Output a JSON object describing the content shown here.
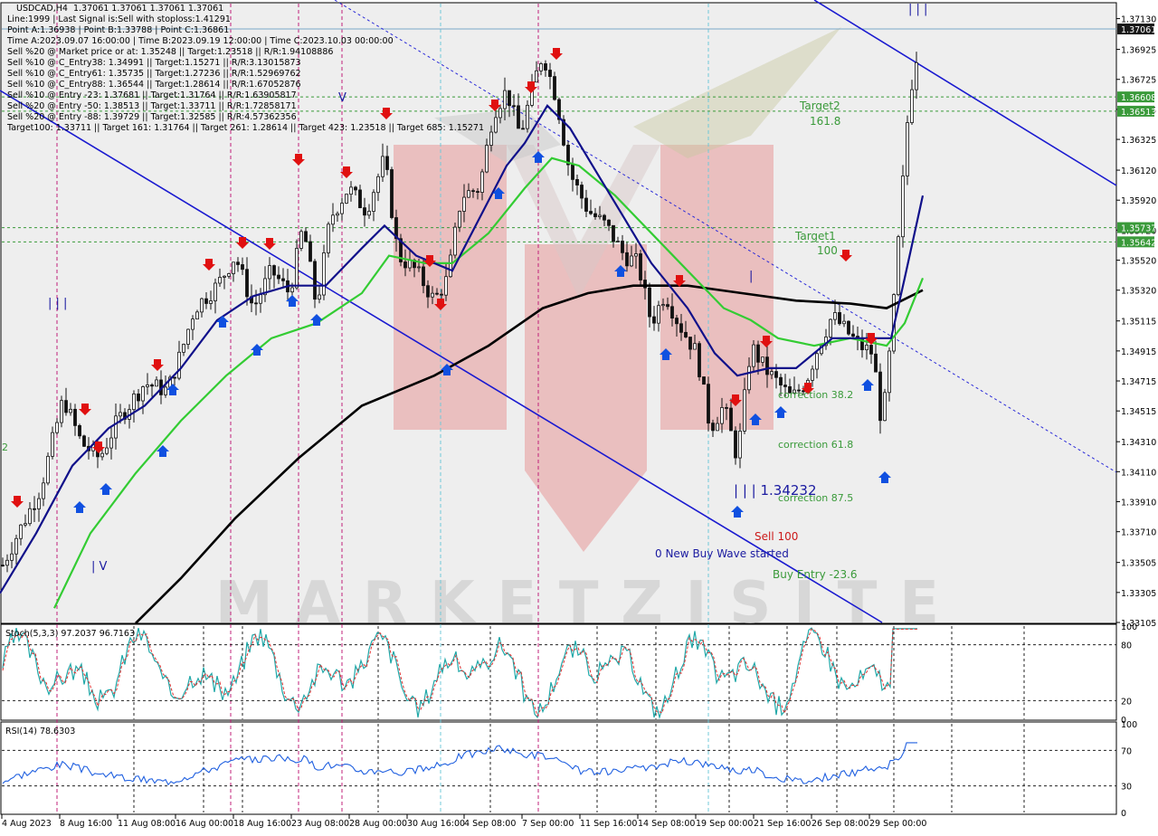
{
  "symbol_header": "USDCAD,H4  1.37061 1.37061 1.37061 1.37061",
  "info_lines": [
    "Line:1999 | Last Signal is:Sell with stoploss:1.41291",
    "Point A:1.36938 | Point B:1.33788 | Point C:1.36861",
    "Time A:2023.09.07 16:00:00 | Time B:2023.09.19 12:00:00 | Time C:2023.10.03 00:00:00",
    "Sell %20 @ Market price or at: 1.35248 || Target:1.23518 || R/R:1.94108886",
    "Sell %10 @ C_Entry38: 1.34991 || Target:1.15271 || R/R:3.13015873",
    "Sell %10 @ C_Entry61: 1.35735 || Target:1.27236 || R/R:1.52969762",
    "Sell %10 @ C_Entry88: 1.36544 || Target:1.28614 || R/R:1.67052876",
    "Sell %10 @ Entry -23: 1.37681 || Target:1.31764 || R/R:1.63905817",
    "Sell %20 @ Entry -50: 1.38513 || Target:1.33711 || R/R:1.72858171",
    "Sell %20 @ Entry -88: 1.39729 || Target:1.32585 || R/R:4.57362356",
    "Target100: 1.33711 || Target 161: 1.31764 || Target 261: 1.28614 || Target 423: 1.23518 || Target 685: 1.15271"
  ],
  "annotations": {
    "target2": "Target2",
    "target2_val": "161.8",
    "target1": "Target1",
    "target1_val": "100",
    "correction382": "correction 38.2",
    "correction618": "correction 61.8",
    "correction875": "correction 87.5",
    "point_b_label": "| | | 1.34232",
    "sell100": "Sell 100",
    "new_buy_wave": "0 New Buy Wave started",
    "buy_entry": "Buy Entry -23.6",
    "wave_iii_left": "| | |",
    "wave_iv_left": "| V",
    "wave_v_top": "V",
    "wave_i_mid": "|",
    "wave_top_right": "| | |",
    "watermark": "MARKETZISITE",
    "left_edge_digit": "2"
  },
  "stoch_label": "Stoch(5,3,3) 97.2037 96.7163",
  "rsi_label": "RSI(14) 78.6303",
  "stoch_levels": [
    "100",
    "80",
    "20",
    "0"
  ],
  "rsi_levels": [
    "100",
    "70",
    "30",
    "0"
  ],
  "price_ticks": [
    "1.37130",
    "1.36925",
    "1.36725",
    "1.36525",
    "1.36325",
    "1.36120",
    "1.35920",
    "1.35720",
    "1.35520",
    "1.35320",
    "1.35115",
    "1.34915",
    "1.34715",
    "1.34515",
    "1.34310",
    "1.34110",
    "1.33910",
    "1.33710",
    "1.33505",
    "1.33305",
    "1.33105"
  ],
  "price_markers": [
    {
      "label": "1.37061",
      "value": 1.37061,
      "color": "#1a1a1a"
    },
    {
      "label": "1.36608",
      "value": 1.36608,
      "color": "#3a9a3a"
    },
    {
      "label": "1.36513",
      "value": 1.36513,
      "color": "#3a9a3a"
    },
    {
      "label": "1.35737",
      "value": 1.35737,
      "color": "#3a9a3a"
    },
    {
      "label": "1.35642",
      "value": 1.35642,
      "color": "#3a9a3a"
    }
  ],
  "time_ticks": [
    "4 Aug 2023",
    "8 Aug 16:00",
    "11 Aug 08:00",
    "16 Aug 00:00",
    "18 Aug 16:00",
    "23 Aug 08:00",
    "28 Aug 00:00",
    "30 Aug 16:00",
    "4 Sep 08:00",
    "7 Sep 00:00",
    "11 Sep 16:00",
    "14 Sep 08:00",
    "19 Sep 00:00",
    "21 Sep 16:00",
    "26 Sep 08:00",
    "29 Sep 00:00"
  ],
  "chart_data": {
    "type": "candlestick",
    "symbol": "USDCAD",
    "timeframe": "H4",
    "ylim": [
      1.33105,
      1.3723
    ],
    "last_price": 1.37061,
    "close_path": [
      [
        0,
        1.3345
      ],
      [
        20,
        1.337
      ],
      [
        45,
        1.34
      ],
      [
        70,
        1.346
      ],
      [
        90,
        1.343
      ],
      [
        110,
        1.342
      ],
      [
        130,
        1.3445
      ],
      [
        160,
        1.347
      ],
      [
        185,
        1.3465
      ],
      [
        200,
        1.349
      ],
      [
        215,
        1.352
      ],
      [
        240,
        1.3535
      ],
      [
        260,
        1.3555
      ],
      [
        280,
        1.352
      ],
      [
        300,
        1.3545
      ],
      [
        320,
        1.353
      ],
      [
        335,
        1.3575
      ],
      [
        350,
        1.352
      ],
      [
        365,
        1.358
      ],
      [
        385,
        1.36
      ],
      [
        405,
        1.3585
      ],
      [
        425,
        1.362
      ],
      [
        440,
        1.3555
      ],
      [
        460,
        1.3545
      ],
      [
        480,
        1.3525
      ],
      [
        495,
        1.354
      ],
      [
        510,
        1.3595
      ],
      [
        530,
        1.36
      ],
      [
        545,
        1.365
      ],
      [
        560,
        1.3665
      ],
      [
        575,
        1.3635
      ],
      [
        590,
        1.367
      ],
      [
        600,
        1.369
      ],
      [
        615,
        1.366
      ],
      [
        630,
        1.361
      ],
      [
        650,
        1.3585
      ],
      [
        670,
        1.3575
      ],
      [
        690,
        1.3555
      ],
      [
        705,
        1.355
      ],
      [
        720,
        1.351
      ],
      [
        735,
        1.353
      ],
      [
        750,
        1.351
      ],
      [
        770,
        1.349
      ],
      [
        785,
        1.344
      ],
      [
        800,
        1.3455
      ],
      [
        815,
        1.342
      ],
      [
        830,
        1.3495
      ],
      [
        845,
        1.348
      ],
      [
        860,
        1.347
      ],
      [
        875,
        1.346
      ],
      [
        890,
        1.347
      ],
      [
        905,
        1.3495
      ],
      [
        920,
        1.3515
      ],
      [
        935,
        1.3505
      ],
      [
        950,
        1.3495
      ],
      [
        965,
        1.349
      ],
      [
        975,
        1.344
      ],
      [
        985,
        1.35
      ],
      [
        995,
        1.358
      ],
      [
        1005,
        1.366
      ],
      [
        1015,
        1.3695
      ]
    ],
    "ma_fast": [
      [
        0,
        1.333
      ],
      [
        40,
        1.337
      ],
      [
        80,
        1.3415
      ],
      [
        120,
        1.344
      ],
      [
        160,
        1.3455
      ],
      [
        200,
        1.348
      ],
      [
        240,
        1.3512
      ],
      [
        280,
        1.3528
      ],
      [
        320,
        1.3535
      ],
      [
        360,
        1.3535
      ],
      [
        400,
        1.356
      ],
      [
        425,
        1.3575
      ],
      [
        460,
        1.3555
      ],
      [
        500,
        1.3545
      ],
      [
        530,
        1.358
      ],
      [
        560,
        1.3615
      ],
      [
        580,
        1.363
      ],
      [
        605,
        1.3655
      ],
      [
        630,
        1.364
      ],
      [
        660,
        1.361
      ],
      [
        690,
        1.358
      ],
      [
        720,
        1.355
      ],
      [
        760,
        1.352
      ],
      [
        790,
        1.349
      ],
      [
        815,
        1.3475
      ],
      [
        850,
        1.348
      ],
      [
        880,
        1.348
      ],
      [
        920,
        1.35
      ],
      [
        960,
        1.35
      ],
      [
        985,
        1.35
      ],
      [
        1000,
        1.354
      ],
      [
        1020,
        1.3595
      ]
    ],
    "ma_mid": [
      [
        60,
        1.332
      ],
      [
        100,
        1.337
      ],
      [
        150,
        1.341
      ],
      [
        200,
        1.3445
      ],
      [
        250,
        1.3475
      ],
      [
        300,
        1.35
      ],
      [
        350,
        1.351
      ],
      [
        400,
        1.353
      ],
      [
        430,
        1.3555
      ],
      [
        470,
        1.355
      ],
      [
        500,
        1.355
      ],
      [
        540,
        1.357
      ],
      [
        580,
        1.36
      ],
      [
        610,
        1.362
      ],
      [
        640,
        1.3615
      ],
      [
        680,
        1.3595
      ],
      [
        720,
        1.357
      ],
      [
        760,
        1.3545
      ],
      [
        800,
        1.352
      ],
      [
        830,
        1.3512
      ],
      [
        860,
        1.35
      ],
      [
        900,
        1.3495
      ],
      [
        940,
        1.35
      ],
      [
        980,
        1.3495
      ],
      [
        1000,
        1.351
      ],
      [
        1020,
        1.354
      ]
    ],
    "ma_slow": [
      [
        150,
        1.331
      ],
      [
        200,
        1.334
      ],
      [
        260,
        1.338
      ],
      [
        330,
        1.342
      ],
      [
        400,
        1.3455
      ],
      [
        480,
        1.3475
      ],
      [
        540,
        1.3495
      ],
      [
        600,
        1.352
      ],
      [
        650,
        1.353
      ],
      [
        700,
        1.3535
      ],
      [
        760,
        1.3535
      ],
      [
        820,
        1.353
      ],
      [
        880,
        1.3525
      ],
      [
        940,
        1.3523
      ],
      [
        980,
        1.352
      ],
      [
        1020,
        1.3532
      ]
    ],
    "fib_levels": [
      {
        "name": "Target2 161.8",
        "values": [
          1.36608,
          1.36513
        ]
      },
      {
        "name": "Target1 100",
        "values": [
          1.35737,
          1.35642
        ]
      }
    ],
    "oscillators": {
      "stoch": {
        "k": 97.2037,
        "d": 96.7163,
        "levels": [
          80,
          20
        ]
      },
      "rsi": {
        "value": 78.6303,
        "levels": [
          70,
          30
        ]
      }
    }
  }
}
